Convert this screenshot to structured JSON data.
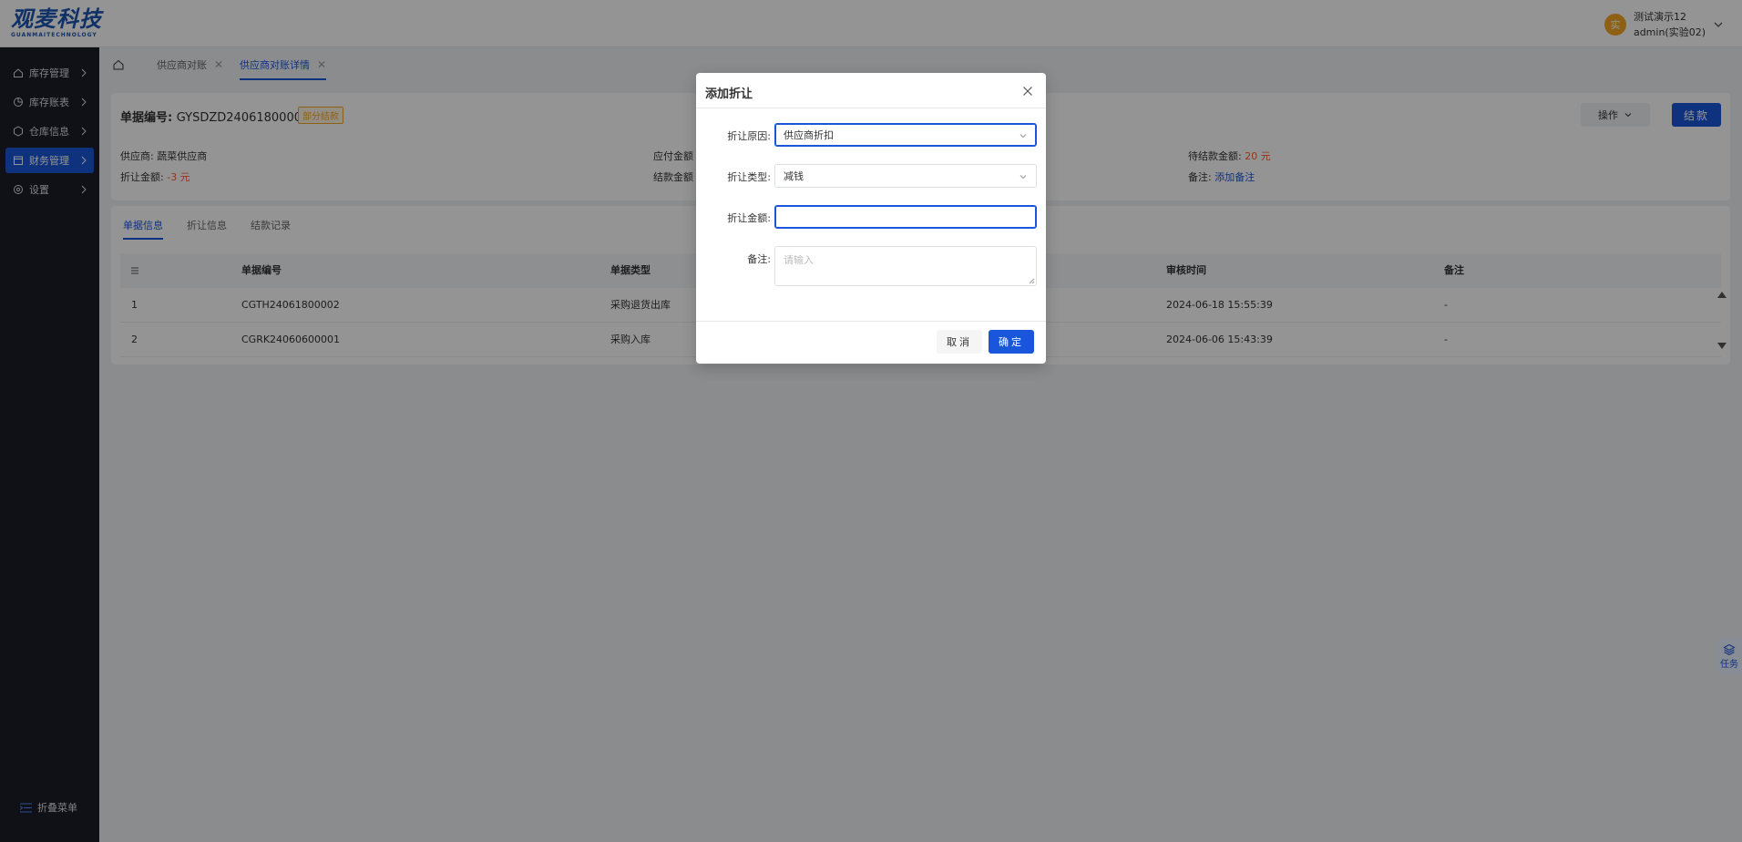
{
  "brand": {
    "logo": "观麦科技",
    "logo_sub": "GUANMAITECHNOLOGY"
  },
  "user": {
    "avatar": "实",
    "name": "测试演示12",
    "account": "admin(实验02)"
  },
  "sidebar": {
    "items": [
      {
        "label": "库存管理",
        "icon": "home-icon"
      },
      {
        "label": "库存账表",
        "icon": "chart-icon"
      },
      {
        "label": "仓库信息",
        "icon": "cube-icon"
      },
      {
        "label": "财务管理",
        "icon": "finance-icon"
      },
      {
        "label": "设置",
        "icon": "gear-icon"
      }
    ],
    "collapse_label": "折叠菜单"
  },
  "tabs": [
    {
      "label": "供应商对账"
    },
    {
      "label": "供应商对账详情"
    }
  ],
  "detail": {
    "doc_no_label": "单据编号:",
    "doc_no": "GYSDZD24061800004",
    "status": "部分结款",
    "op_label": "操作",
    "settle_label": "结款",
    "supplier_label": "供应商:",
    "supplier": "蔬菜供应商",
    "discount_label": "折让金额:",
    "discount": "-3 元",
    "payable_label": "应付金额",
    "settled_label": "结款金额",
    "pending_label": "待结款金额:",
    "pending": "20 元",
    "remark_label": "备注:",
    "remark_link": "添加备注"
  },
  "subtabs": [
    {
      "label": "单据信息"
    },
    {
      "label": "折让信息"
    },
    {
      "label": "结款记录"
    }
  ],
  "table": {
    "columns": [
      "单据编号",
      "单据类型",
      "审核时间",
      "备注"
    ],
    "rows": [
      {
        "idx": "1",
        "no": "CGTH24061800002",
        "type": "采购退货出库",
        "time": "2024-06-18 15:55:39",
        "remark": "-"
      },
      {
        "idx": "2",
        "no": "CGRK24060600001",
        "type": "采购入库",
        "time": "2024-06-06 15:43:39",
        "remark": "-"
      }
    ]
  },
  "task_label": "任务",
  "modal": {
    "title": "添加折让",
    "reason_label": "折让原因:",
    "reason_value": "供应商折扣",
    "type_label": "折让类型:",
    "type_value": "减钱",
    "amount_label": "折让金额:",
    "amount_value": "",
    "remark_label": "备注:",
    "remark_placeholder": "请输入",
    "cancel": "取消",
    "ok": "确定"
  },
  "colors": {
    "primary": "#1a56db",
    "sidebar_bg": "#1c1e26",
    "warn": "#f5a623",
    "danger": "#ff5b2e"
  }
}
